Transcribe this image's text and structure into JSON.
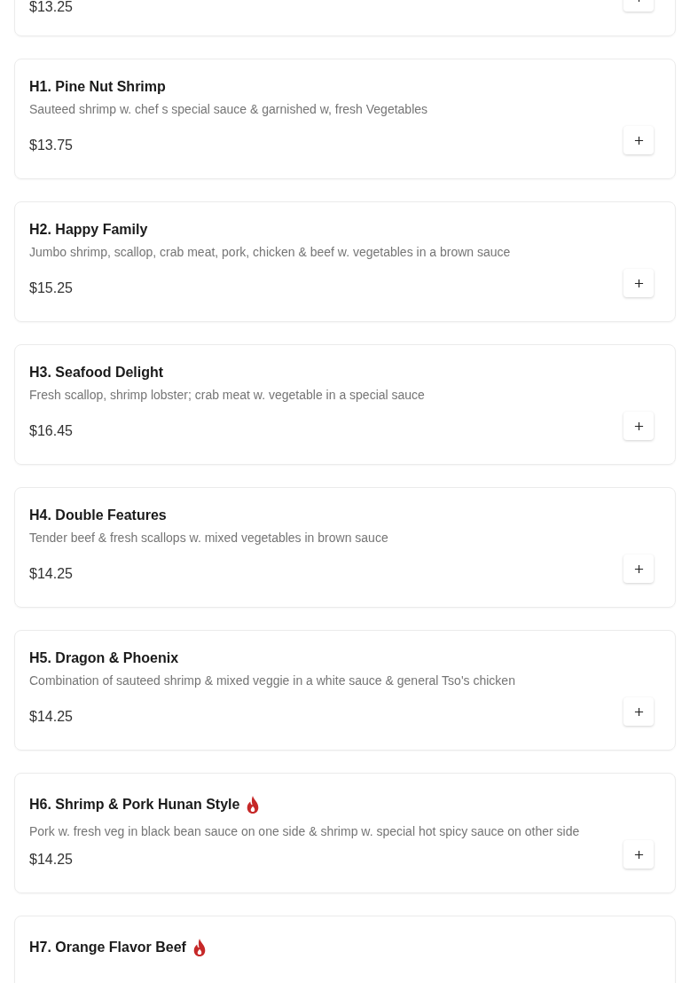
{
  "items": [
    {
      "price": "$13.25"
    },
    {
      "name": "H1. Pine Nut Shrimp",
      "description": "Sauteed shrimp w. chef s special sauce & garnished w, fresh Vegetables",
      "price": "$13.75",
      "spicy": false
    },
    {
      "name": "H2. Happy Family",
      "description": "Jumbo shrimp, scallop, crab meat, pork, chicken & beef w. vegetables in a brown sauce",
      "price": "$15.25",
      "spicy": false
    },
    {
      "name": "H3. Seafood Delight",
      "description": "Fresh scallop, shrimp lobster; crab meat w. vegetable in a special sauce",
      "price": "$16.45",
      "spicy": false
    },
    {
      "name": "H4. Double Features",
      "description": "Tender beef & fresh scallops w. mixed vegetables in brown sauce",
      "price": "$14.25",
      "spicy": false
    },
    {
      "name": "H5. Dragon & Phoenix",
      "description": "Combination of sauteed shrimp & mixed veggie in a white sauce & general Tso's chicken",
      "price": "$14.25",
      "spicy": false
    },
    {
      "name": "H6. Shrimp & Pork Hunan Style",
      "description": "Pork w. fresh veg in black bean sauce on one side & shrimp w. special hot spicy sauce on other side",
      "price": "$14.25",
      "spicy": true
    },
    {
      "name": "H7. Orange Flavor Beef",
      "spicy": true
    }
  ]
}
